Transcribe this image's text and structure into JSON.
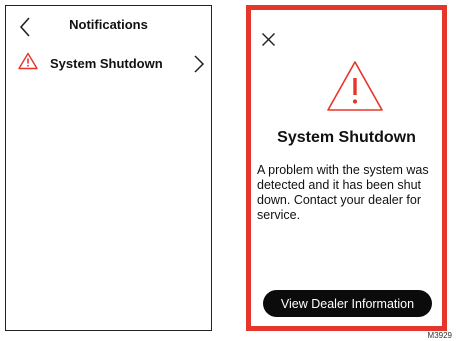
{
  "notifications": {
    "title": "Notifications",
    "items": [
      {
        "label": "System Shutdown",
        "icon": "warning-triangle-icon"
      }
    ]
  },
  "alert": {
    "title": "System Shutdown",
    "message": "A problem with the system was detected and it has been shut down. Contact your dealer for service.",
    "button_label": "View Dealer Information"
  },
  "figure_id": "M3929",
  "colors": {
    "alert_red": "#e5362b",
    "button_bg": "#0b0b0b",
    "text": "#111111"
  }
}
